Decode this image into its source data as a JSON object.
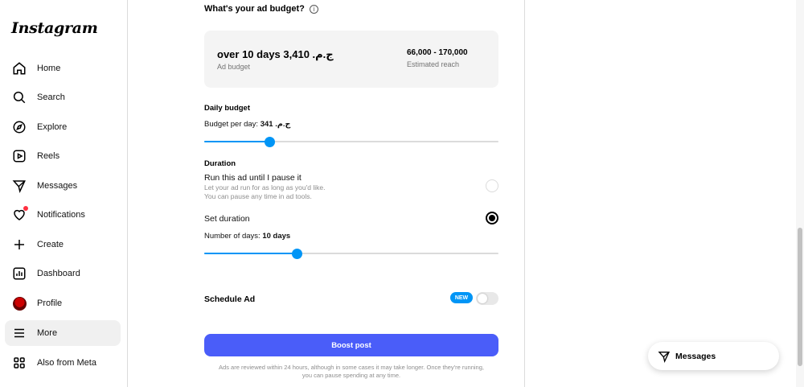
{
  "sidebar": {
    "logo": "Instagram",
    "items": [
      {
        "label": "Home",
        "icon": "home-icon"
      },
      {
        "label": "Search",
        "icon": "search-icon"
      },
      {
        "label": "Explore",
        "icon": "compass-icon"
      },
      {
        "label": "Reels",
        "icon": "reels-icon"
      },
      {
        "label": "Messages",
        "icon": "send-icon"
      },
      {
        "label": "Notifications",
        "icon": "heart-icon"
      },
      {
        "label": "Create",
        "icon": "plus-icon"
      },
      {
        "label": "Dashboard",
        "icon": "dashboard-icon"
      },
      {
        "label": "Profile",
        "icon": "avatar"
      },
      {
        "label": "More",
        "icon": "menu-icon"
      },
      {
        "label": "Also from Meta",
        "icon": "grid-icon"
      }
    ]
  },
  "budget": {
    "heading": "What's your ad budget?",
    "amount": "over 10 days 3,410 .ج.م",
    "amount_label": "Ad budget",
    "reach": "66,000 - 170,000",
    "reach_label": "Estimated reach"
  },
  "daily": {
    "heading": "Daily budget",
    "per_day_label": "Budget per day:",
    "per_day_value": "341 .ج.م",
    "slider_fraction": 0.22
  },
  "duration": {
    "heading": "Duration",
    "option1_title": "Run this ad until I pause it",
    "option1_line1": "Let your ad run for as long as you'd like.",
    "option1_line2": "You can pause any time in ad tools.",
    "option2_title": "Set duration",
    "days_label": "Number of days:",
    "days_value": "10 days",
    "slider_fraction": 0.315
  },
  "schedule": {
    "label": "Schedule Ad",
    "badge": "NEW"
  },
  "boost_label": "Boost post",
  "footnote_line1": "Ads are reviewed within 24 hours, although in some cases it may take longer. Once they're running,",
  "footnote_line2": "you can pause spending at any time.",
  "messages_button": "Messages",
  "colors": {
    "accent": "#0095f6",
    "boost": "#4a5df9",
    "notification": "#ff3040"
  }
}
